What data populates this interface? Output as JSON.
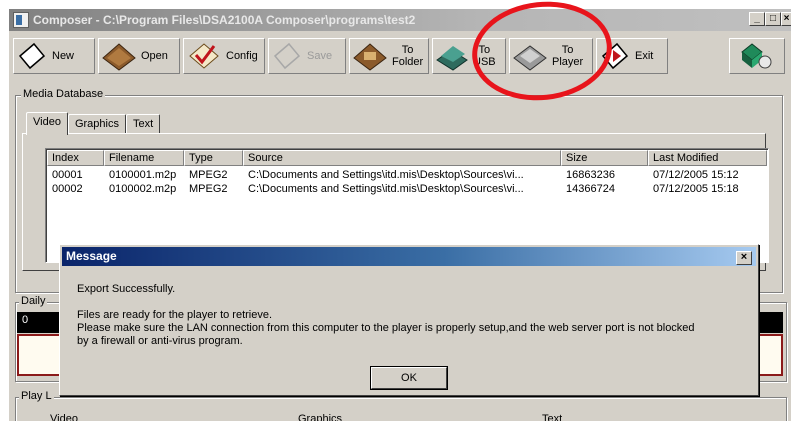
{
  "window": {
    "title": "Composer - C:\\Program Files\\DSA2100A Composer\\programs\\test2",
    "minimize_glyph": "_",
    "restore_glyph": "□",
    "close_glyph": "×"
  },
  "toolbar": {
    "new_label": "New",
    "open_label": "Open",
    "config_label": "Config",
    "save_label": "Save",
    "to_folder_line1": "To",
    "to_folder_line2": "Folder",
    "to_usb_line1": "To",
    "to_usb_line2": "USB",
    "to_player_line1": "To",
    "to_player_line2": "Player",
    "exit_label": "Exit"
  },
  "media_database": {
    "group_label": "Media Database",
    "tabs": [
      "Video",
      "Graphics",
      "Text"
    ],
    "columns": [
      "Index",
      "Filename",
      "Type",
      "Source",
      "Size",
      "Last Modified"
    ],
    "rows": [
      [
        "00001",
        "0100001.m2p",
        "MPEG2",
        "C:\\Documents and Settings\\itd.mis\\Desktop\\Sources\\vi...",
        "16863236",
        "07/12/2005 15:12"
      ],
      [
        "00002",
        "0100002.m2p",
        "MPEG2",
        "C:\\Documents and Settings\\itd.mis\\Desktop\\Sources\\vi...",
        "14366724",
        "07/12/2005 15:18"
      ]
    ]
  },
  "daily": {
    "group_label": "Daily",
    "cell_value": "0"
  },
  "play_list": {
    "group_label": "Play L",
    "col_video": "Video",
    "col_graphics": "Graphics",
    "col_text": "Text"
  },
  "dialog": {
    "title": "Message",
    "close_glyph": "×",
    "line1": "Export Successfully.",
    "line2": "Files are ready for the player to retrieve.",
    "line3": "Please make sure the LAN connection from this computer to the player is properly setup,and the web server port is not blocked",
    "line4": "by a firewall or anti-virus program.",
    "ok_label": "OK"
  },
  "colors": {
    "annotation_circle": "#e8141b",
    "dialog_title_start": "#0a246a",
    "window_face": "#d4d0c8"
  },
  "icons": [
    "new-page-icon",
    "open-folder-icon",
    "config-check-icon",
    "save-page-icon",
    "to-folder-icon",
    "to-usb-icon",
    "to-player-icon",
    "exit-door-icon",
    "network-device-icon"
  ]
}
